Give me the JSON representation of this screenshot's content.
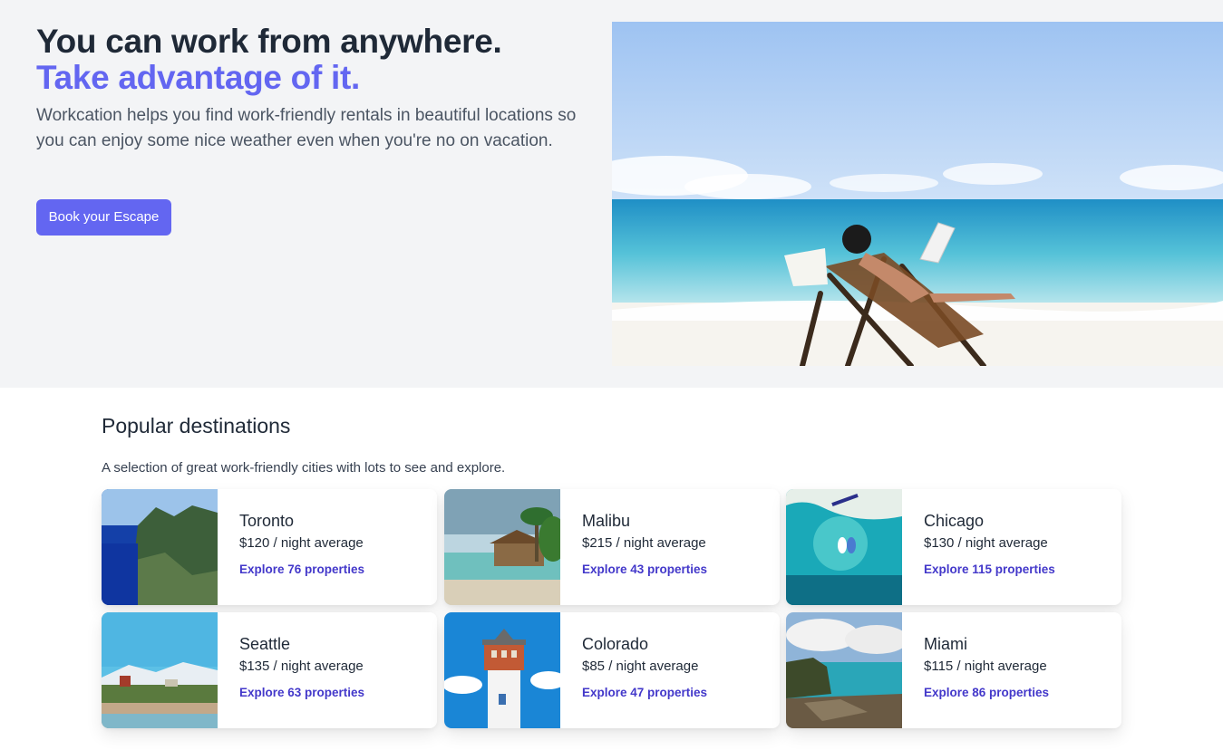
{
  "hero": {
    "headline": "You can work from anywhere.",
    "headline_accent": "Take advantage of it.",
    "description": "Workcation helps you find work-friendly rentals in beautiful locations so you can enjoy some nice weather even when you're no on vacation.",
    "cta_label": "Book your Escape"
  },
  "destinations": {
    "title": "Popular destinations",
    "subtitle": "A selection of great work-friendly cities with lots to see and explore.",
    "items": [
      {
        "city": "Toronto",
        "price": "$120 / night average",
        "explore": "Explore 76 properties"
      },
      {
        "city": "Malibu",
        "price": "$215 / night average",
        "explore": "Explore 43 properties"
      },
      {
        "city": "Chicago",
        "price": "$130 / night average",
        "explore": "Explore 115 properties"
      },
      {
        "city": "Seattle",
        "price": "$135 / night average",
        "explore": "Explore 63 properties"
      },
      {
        "city": "Colorado",
        "price": "$85 / night average",
        "explore": "Explore 47 properties"
      },
      {
        "city": "Miami",
        "price": "$115 / night average",
        "explore": "Explore 86 properties"
      }
    ]
  },
  "colors": {
    "accent": "#6366f1",
    "link": "#4338ca",
    "hero_bg": "#f3f4f6"
  }
}
